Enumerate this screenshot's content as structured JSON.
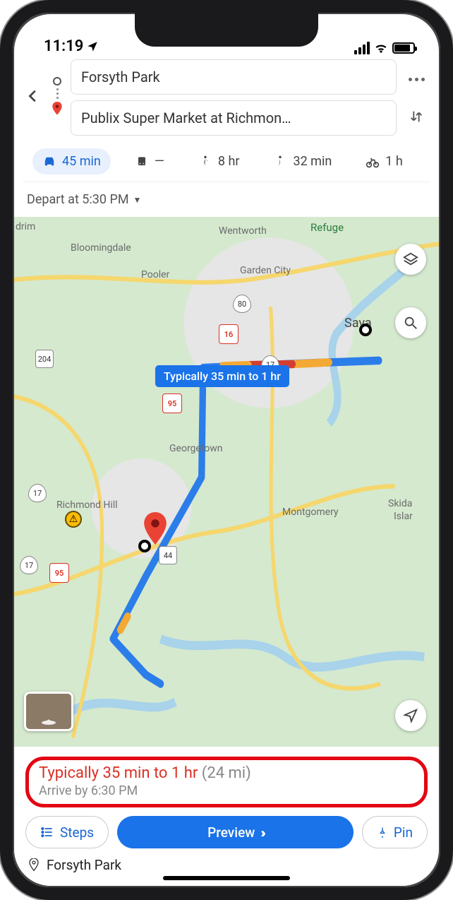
{
  "status": {
    "time": "11:19"
  },
  "header": {
    "from": "Forsyth Park",
    "to": "Publix Super Market at Richmon…"
  },
  "modes": {
    "car": "45 min",
    "transit": "—",
    "walk": "8 hr",
    "ride": "32 min",
    "bike": "1 h"
  },
  "depart": "Depart at 5:30 PM",
  "map": {
    "tooltip": "Typically 35 min to 1 hr",
    "cities": {
      "wentworth": "Wentworth",
      "bloomingdale": "Bloomingdale",
      "pooler": "Pooler",
      "gardencity": "Garden City",
      "drim": "drim",
      "savannah": "Sava",
      "georgetown": "Georgetown",
      "richmondhill": "Richmond Hill",
      "montgomery": "Montgomery",
      "skidaway": "Skida",
      "island": "Islar",
      "refuge": "Refuge"
    },
    "shields": {
      "i16": "16",
      "i95": "95",
      "i95b": "95",
      "us80": "80",
      "us17a": "17",
      "us17b": "17",
      "us17c": "17",
      "ga204": "204",
      "ga144": "44"
    }
  },
  "card": {
    "time": "Typically 35 min to 1 hr",
    "distance": "(24 mi)",
    "arrive": "Arrive by 6:30 PM",
    "steps": "Steps",
    "preview": "Preview",
    "pin": "Pin",
    "below": "Forsyth Park"
  }
}
